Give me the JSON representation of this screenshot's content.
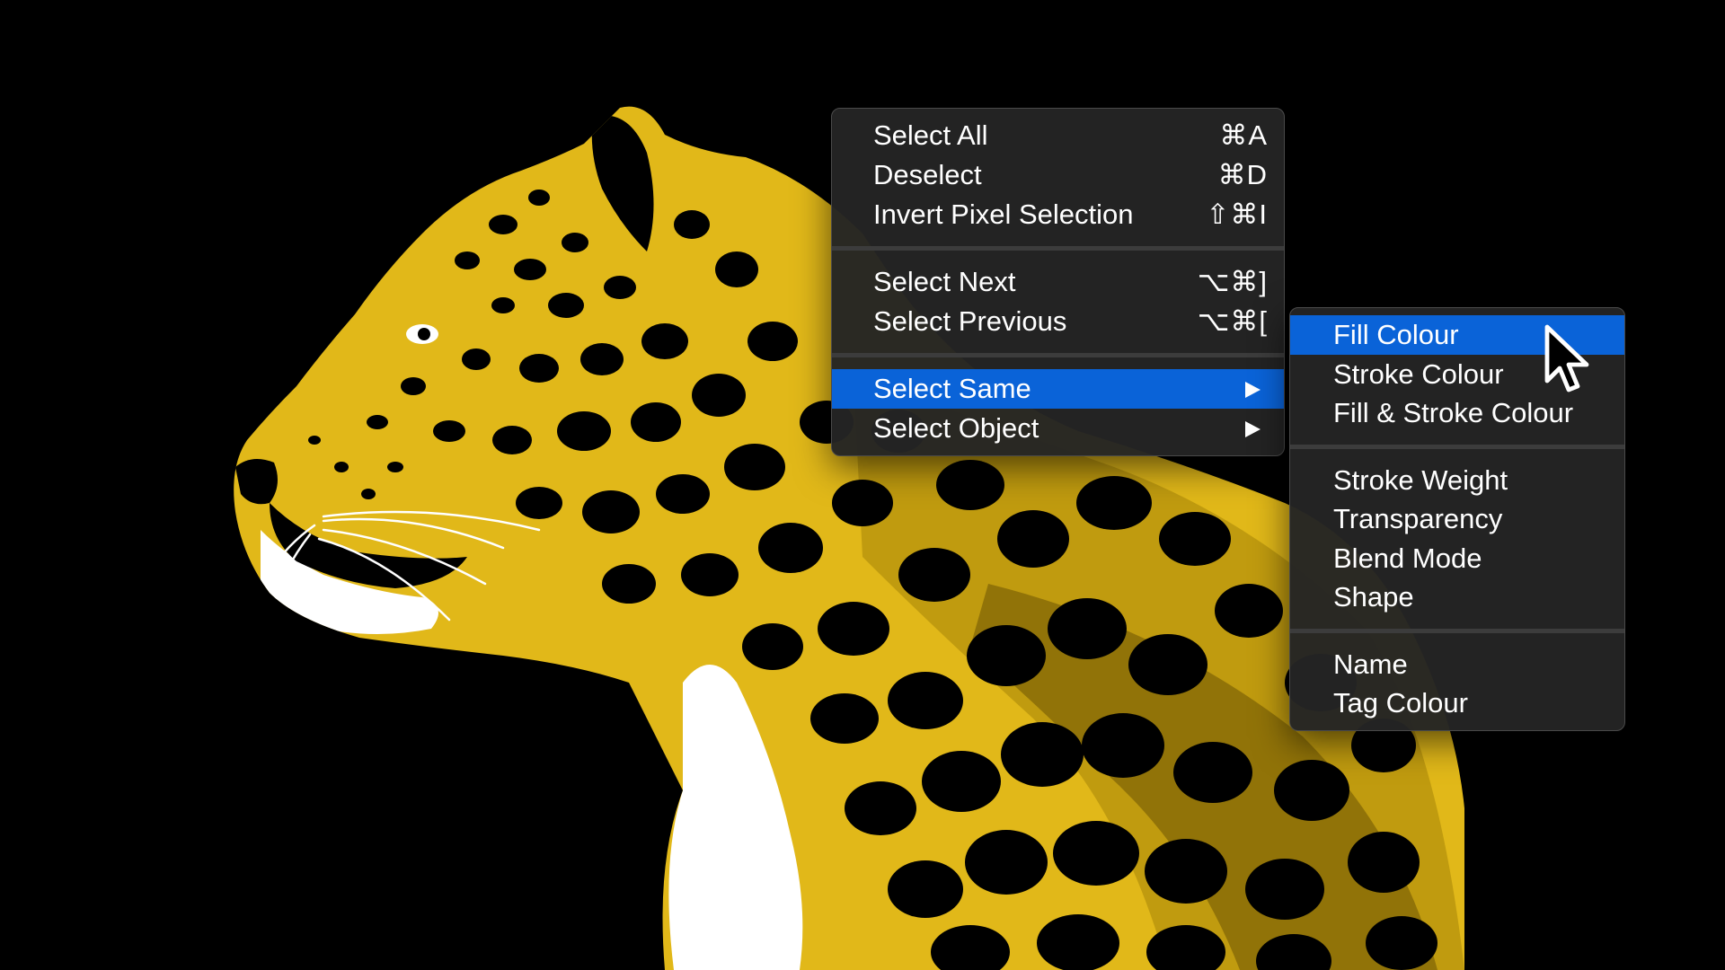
{
  "main_menu": {
    "items": [
      {
        "label": "Select All",
        "shortcut": "⌘A"
      },
      {
        "label": "Deselect",
        "shortcut": "⌘D"
      },
      {
        "label": "Invert Pixel Selection",
        "shortcut": "⇧⌘I"
      },
      {
        "label": "Select Next",
        "shortcut": "⌥⌘]"
      },
      {
        "label": "Select Previous",
        "shortcut": "⌥⌘["
      },
      {
        "label": "Select Same",
        "submenu": true,
        "highlighted": true
      },
      {
        "label": "Select Object",
        "submenu": true
      }
    ]
  },
  "sub_menu": {
    "items": [
      {
        "label": "Fill Colour",
        "highlighted": true
      },
      {
        "label": "Stroke Colour"
      },
      {
        "label": "Fill & Stroke Colour"
      },
      {
        "label": "Stroke Weight"
      },
      {
        "label": "Transparency"
      },
      {
        "label": "Blend Mode"
      },
      {
        "label": "Shape"
      },
      {
        "label": "Name"
      },
      {
        "label": "Tag Colour"
      }
    ]
  },
  "colors": {
    "background": "#000000",
    "menu_background": "#242424",
    "highlight": "#0a63d8",
    "text": "#ffffff",
    "artwork_fur": "#e1b819",
    "artwork_shade": "#9a7b0a"
  },
  "icons": {
    "submenu_arrow": "triangle-right-icon",
    "pointer": "arrow-cursor-icon"
  }
}
